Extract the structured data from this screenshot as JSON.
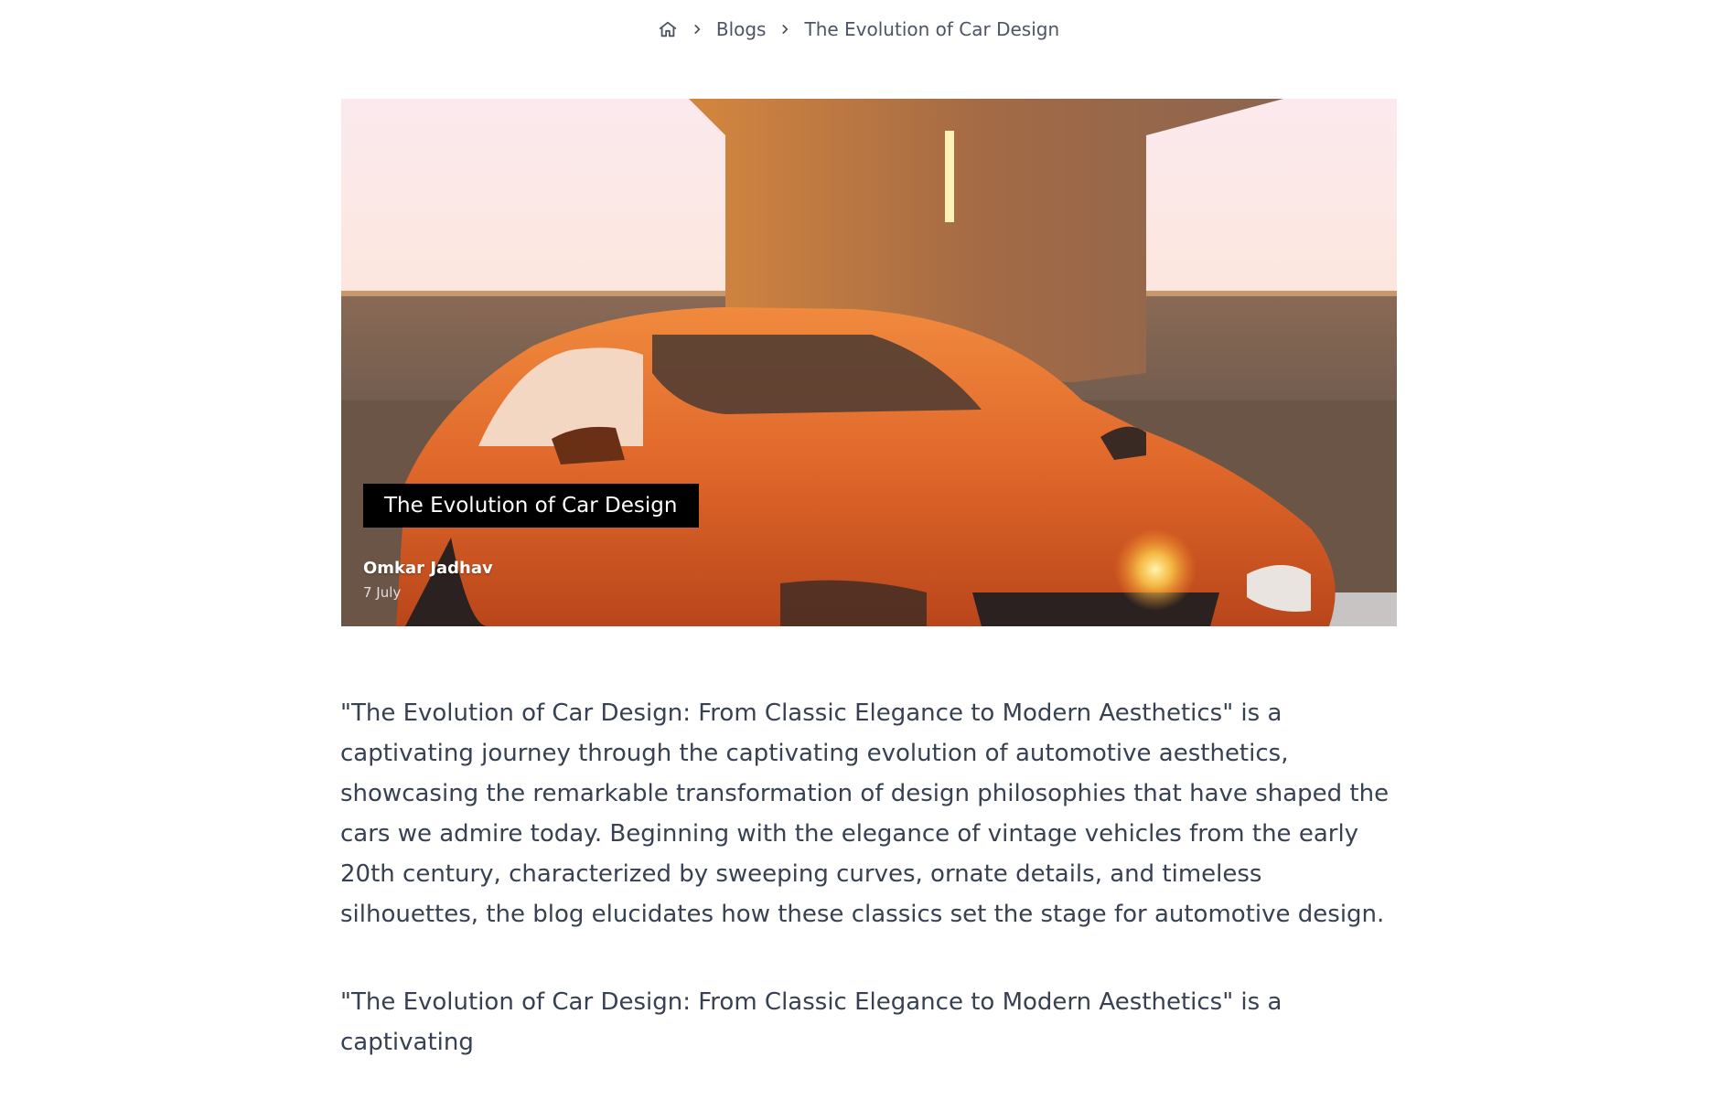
{
  "breadcrumb": {
    "home_icon": "home-icon",
    "separator_icon": "chevron-right-icon",
    "items": [
      "Blogs",
      "The Evolution of Car Design"
    ]
  },
  "hero": {
    "title": "The Evolution of Car Design",
    "author": "Omkar Jadhav",
    "date": "7 July"
  },
  "article": {
    "paragraphs": [
      "\"The Evolution of Car Design: From Classic Elegance to Modern Aesthetics\" is a captivating journey through the captivating evolution of automotive aesthetics, showcasing the remarkable transformation of design philosophies that have shaped the cars we admire today. Beginning with the elegance of vintage vehicles from the early 20th century, characterized by sweeping curves, ornate details, and timeless silhouettes, the blog elucidates how these classics set the stage for automotive design.",
      "\"The Evolution of Car Design: From Classic Elegance to Modern Aesthetics\" is a captivating"
    ]
  },
  "colors": {
    "accent_orange": "#e0672a",
    "text": "#374151"
  }
}
